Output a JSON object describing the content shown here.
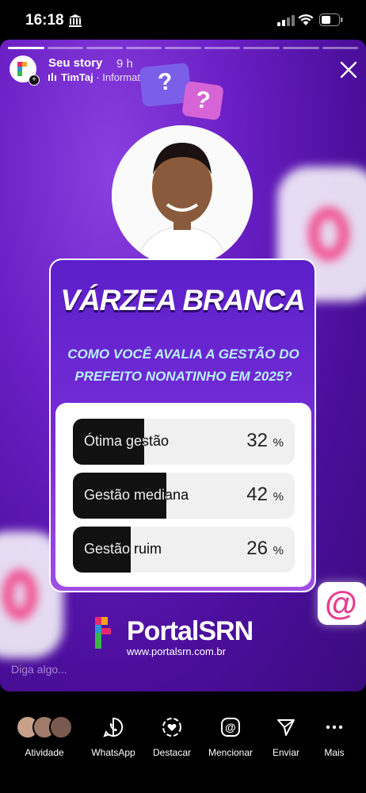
{
  "status_bar": {
    "time": "16:18"
  },
  "story": {
    "username": "Seu story",
    "age": "9 h",
    "music": "TimTaj",
    "music_sep": " · ",
    "music_info": "Information",
    "reply_placeholder": "Diga algo...",
    "progress_segments": 9,
    "progress_done": 1
  },
  "post": {
    "title": "VÁRZEA BRANCA",
    "question_line1": "COMO VOCÊ AVALIA A GESTÃO DO",
    "question_line2": "PREFEITO NONATINHO EM 2025?",
    "poll": [
      {
        "label": "Ótima gestão",
        "percent": 32,
        "percent_text": "32"
      },
      {
        "label": "Gestão mediana",
        "percent": 42,
        "percent_text": "42"
      },
      {
        "label": "Gestão ruim",
        "percent": 26,
        "percent_text": "26"
      }
    ],
    "percent_sign": "%",
    "brand_name": "PortalSRN",
    "brand_url": "www.portalsrn.com.br"
  },
  "actions": [
    {
      "label": "Atividade",
      "icon": "activity-avatars-icon"
    },
    {
      "label": "WhatsApp",
      "icon": "whatsapp-icon"
    },
    {
      "label": "Destacar",
      "icon": "highlight-heart-icon"
    },
    {
      "label": "Mencionar",
      "icon": "mention-icon"
    },
    {
      "label": "Enviar",
      "icon": "send-icon"
    },
    {
      "label": "Mais",
      "icon": "more-icon"
    }
  ],
  "colors": {
    "story_bg": "#6a1fc4",
    "question": "#b9f0ff",
    "mention_pink": "#e83d8e"
  }
}
